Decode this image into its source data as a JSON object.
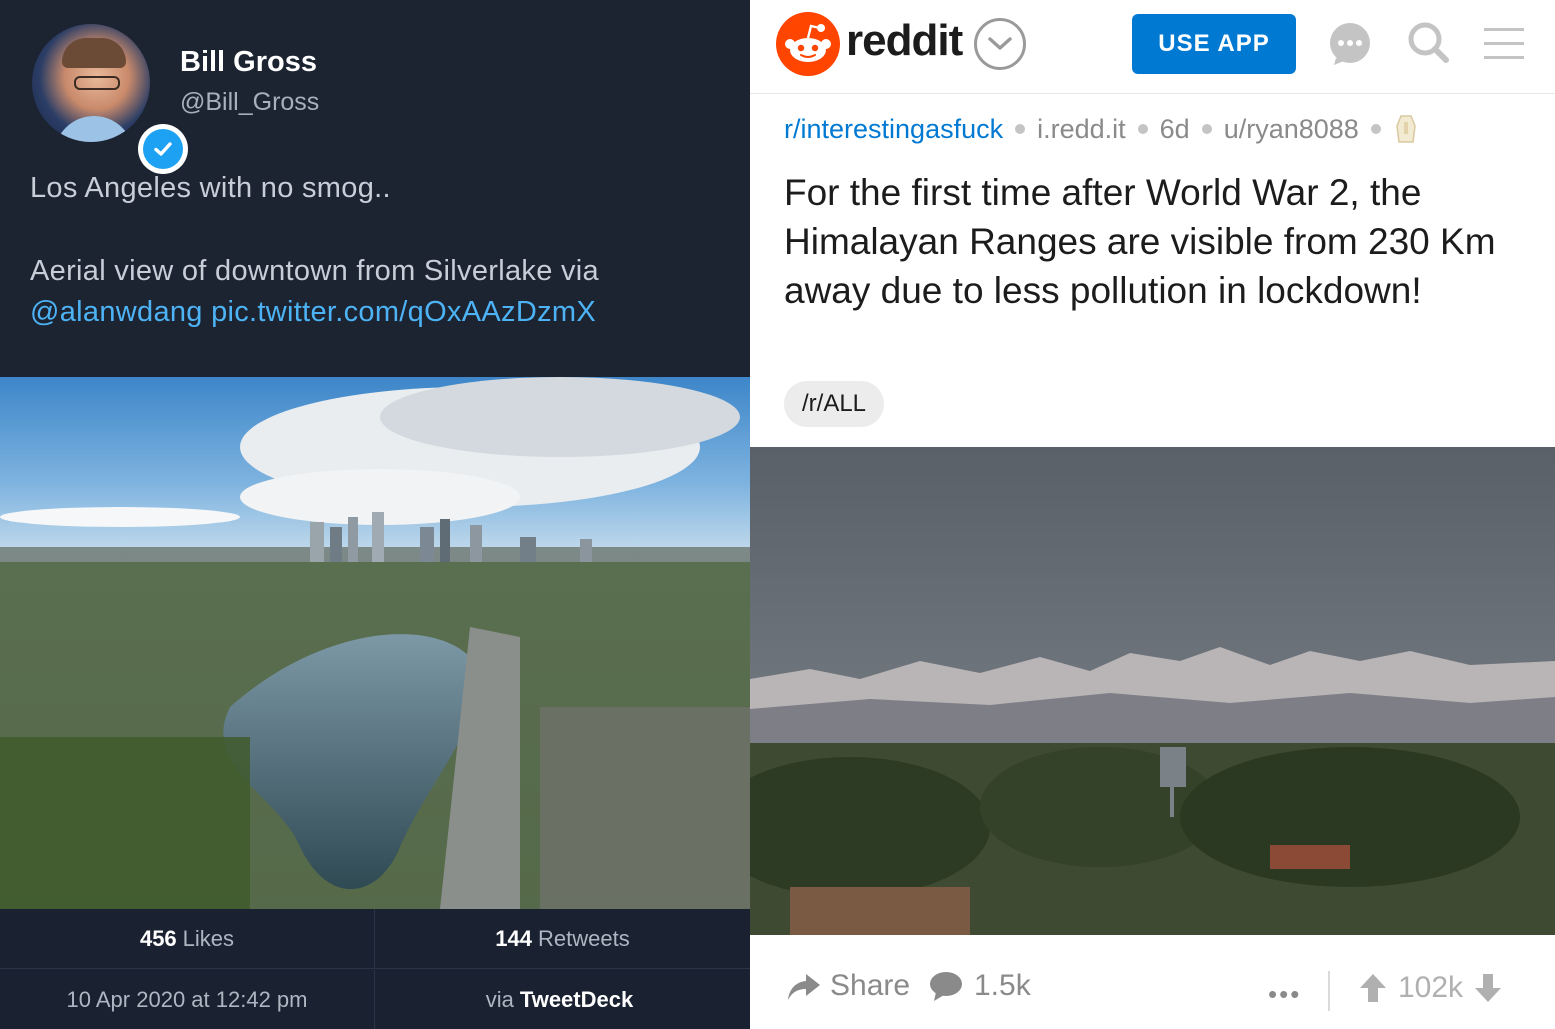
{
  "twitter": {
    "name": "Bill Gross",
    "handle": "@Bill_Gross",
    "text_line1": "Los Angeles with no smog..",
    "text_line2": "Aerial view of downtown from Silverlake via",
    "text_link": "@alanwdang pic.twitter.com/qOxAAzDzmX",
    "likes_count": "456",
    "likes_label": "Likes",
    "retweets_count": "144",
    "retweets_label": "Retweets",
    "date": "10 Apr 2020 at 12:42 pm",
    "via_prefix": "via",
    "via_app": "TweetDeck",
    "colors": {
      "background": "#1c2331",
      "link": "#4db3f5",
      "verified": "#1da1f2"
    },
    "icons": [
      "avatar",
      "verified-icon"
    ]
  },
  "reddit": {
    "wordmark": "reddit",
    "use_app_label": "USE APP",
    "subreddit": "r/interestingasfuck",
    "domain": "i.redd.it",
    "age": "6d",
    "user": "u/ryan8088",
    "title": "For the first time after World War 2, the Himalayan Ranges are visible from 230 Km away due to less pollution in lockdown!",
    "flair": "/r/ALL",
    "share_label": "Share",
    "comments_count": "1.5k",
    "more_label": "•••",
    "score": "102k",
    "colors": {
      "brand": "#ff4500",
      "button": "#0079d3",
      "link": "#0079d3"
    },
    "icons": [
      "reddit-logo-icon",
      "chevron-down-icon",
      "chat-icon",
      "search-icon",
      "menu-icon",
      "award-icon",
      "share-icon",
      "comment-icon",
      "upvote-icon",
      "downvote-icon"
    ]
  }
}
